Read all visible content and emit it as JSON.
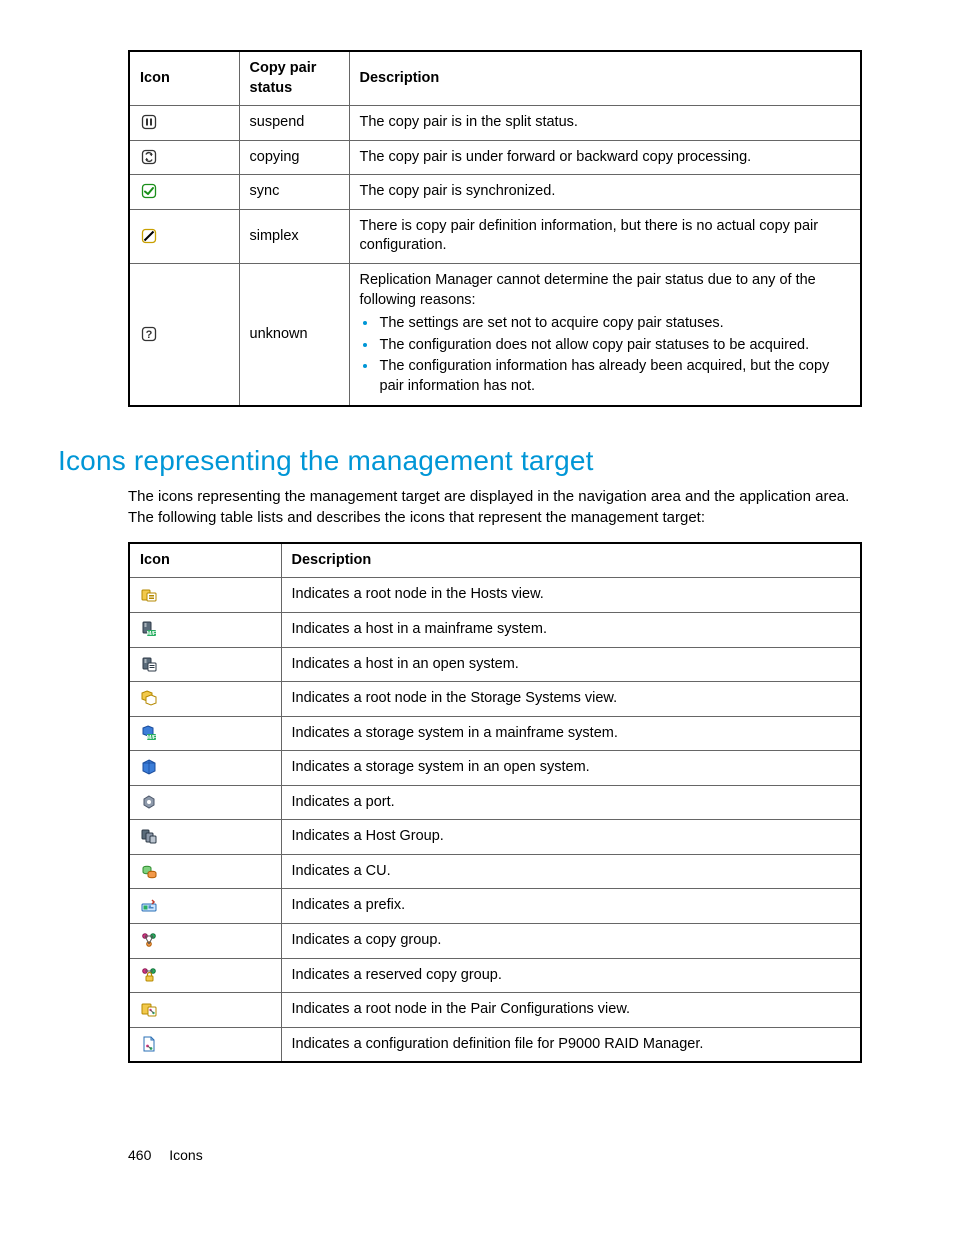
{
  "table1": {
    "headers": {
      "icon": "Icon",
      "status": "Copy pair status",
      "desc": "Description"
    },
    "rows": [
      {
        "status": "suspend",
        "desc": "The copy pair is in the split status."
      },
      {
        "status": "copying",
        "desc": "The copy pair is under forward or backward copy processing."
      },
      {
        "status": "sync",
        "desc": "The copy pair is synchronized."
      },
      {
        "status": "simplex",
        "desc": "There is copy pair definition information, but there is no actual copy pair configuration."
      },
      {
        "status": "unknown",
        "desc_intro": "Replication Manager cannot determine the pair status due to any of the following reasons:",
        "bullets": [
          "The settings are set not to acquire copy pair statuses.",
          "The configuration does not allow copy pair statuses to be acquired.",
          "The configuration information has already been acquired, but the copy pair information has not."
        ]
      }
    ]
  },
  "section": {
    "title": "Icons representing the management target",
    "intro": "The icons representing the management target are displayed in the navigation area and the application area. The following table lists and describes the icons that represent the management target:"
  },
  "table2": {
    "headers": {
      "icon": "Icon",
      "desc": "Description"
    },
    "rows": [
      {
        "desc": "Indicates a root node in the Hosts view."
      },
      {
        "desc": "Indicates a host in a mainframe system."
      },
      {
        "desc": "Indicates a host in an open system."
      },
      {
        "desc": "Indicates a root node in the Storage Systems view."
      },
      {
        "desc": "Indicates a storage system in a mainframe system."
      },
      {
        "desc": "Indicates a storage system in an open system."
      },
      {
        "desc": "Indicates a port."
      },
      {
        "desc": "Indicates a Host Group."
      },
      {
        "desc": "Indicates a CU."
      },
      {
        "desc": "Indicates a prefix."
      },
      {
        "desc": "Indicates a copy group."
      },
      {
        "desc": "Indicates a reserved copy group."
      },
      {
        "desc": "Indicates a root node in the Pair Configurations view."
      },
      {
        "desc": "Indicates a configuration definition file for P9000 RAID Manager."
      }
    ]
  },
  "footer": {
    "page": "460",
    "chapter": "Icons"
  }
}
